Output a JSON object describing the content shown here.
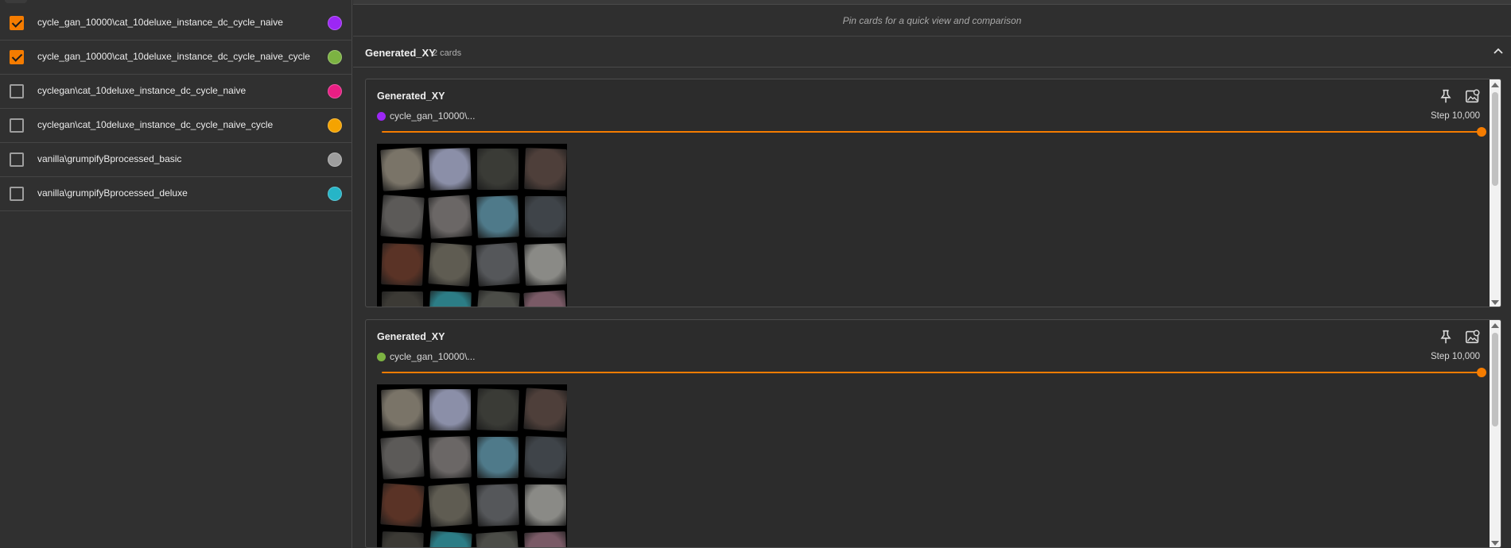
{
  "runs": [
    {
      "label": "cycle_gan_10000\\cat_10deluxe_instance_dc_cycle_naive",
      "checked": true,
      "color": "#9c27f5"
    },
    {
      "label": "cycle_gan_10000\\cat_10deluxe_instance_dc_cycle_naive_cycle",
      "checked": true,
      "color": "#7cb342"
    },
    {
      "label": "cyclegan\\cat_10deluxe_instance_dc_cycle_naive",
      "checked": false,
      "color": "#e91e84"
    },
    {
      "label": "cyclegan\\cat_10deluxe_instance_dc_cycle_naive_cycle",
      "checked": false,
      "color": "#f5a300"
    },
    {
      "label": "vanilla\\grumpifyBprocessed_basic",
      "checked": false,
      "color": "#9e9e9e"
    },
    {
      "label": "vanilla\\grumpifyBprocessed_deluxe",
      "checked": false,
      "color": "#26b5c7"
    }
  ],
  "pin_banner": "Pin cards for a quick view and comparison",
  "group": {
    "title": "Generated_XY",
    "count": "2 cards"
  },
  "cards": [
    {
      "title": "Generated_XY",
      "run": "cycle_gan_10000\\...",
      "run_color": "#9c27f5",
      "step": "Step 10,000",
      "slider_fraction": 1.0
    },
    {
      "title": "Generated_XY",
      "run": "cycle_gan_10000\\...",
      "run_color": "#7cb342",
      "step": "Step 10,000",
      "slider_fraction": 1.0
    }
  ],
  "icons": {
    "pin": "pin-icon",
    "image_settings": "image-settings-icon",
    "collapse": "chevron-up-icon"
  },
  "accent_color": "#f57c00"
}
